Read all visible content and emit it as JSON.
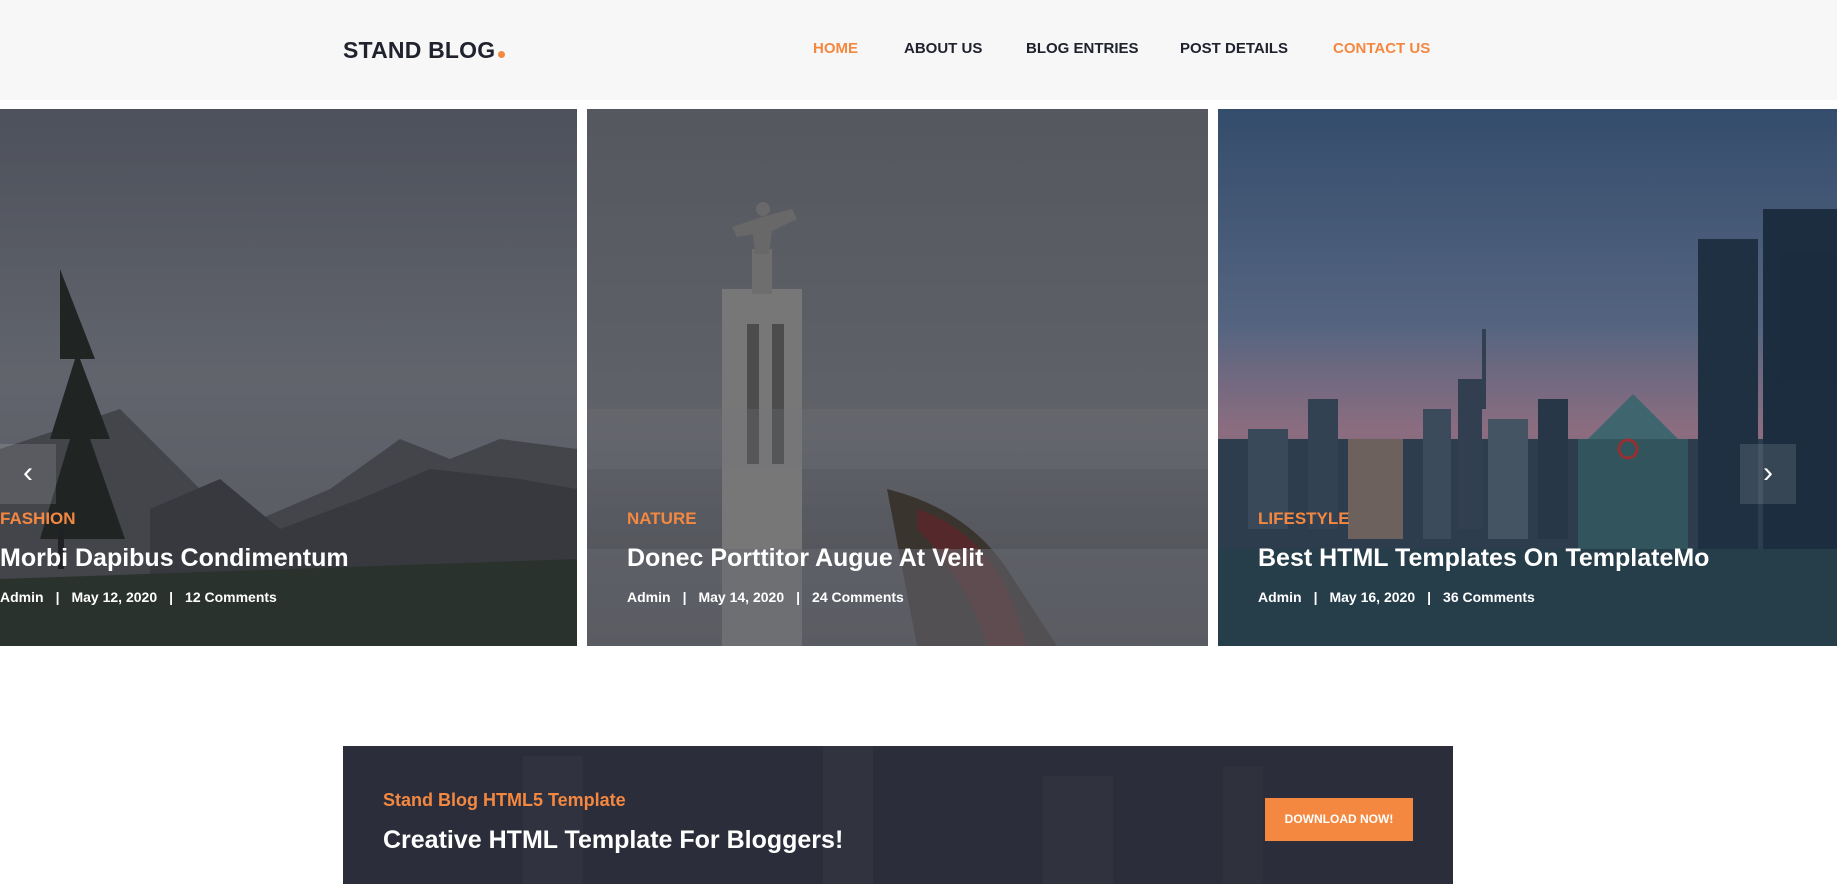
{
  "brand": {
    "name": "STAND BLOG",
    "accent_color": "#f48840"
  },
  "nav": [
    {
      "label": "HOME",
      "active": true
    },
    {
      "label": "ABOUT US",
      "active": false
    },
    {
      "label": "BLOG ENTRIES",
      "active": false
    },
    {
      "label": "POST DETAILS",
      "active": false
    },
    {
      "label": "CONTACT US",
      "active": true
    }
  ],
  "slider": {
    "prev_icon": "chevron-left-icon",
    "prev_glyph": "‹",
    "next_icon": "chevron-right-icon",
    "next_glyph": "›",
    "slides": [
      {
        "category": "FASHION",
        "title": "Morbi Dapibus Condimentum",
        "author": "Admin",
        "date": "May 12, 2020",
        "comments": "12 Comments",
        "image": "mountain-landscape"
      },
      {
        "category": "NATURE",
        "title": "Donec Porttitor Augue At Velit",
        "author": "Admin",
        "date": "May 14, 2020",
        "comments": "24 Comments",
        "image": "statue-in-clouds"
      },
      {
        "category": "LIFESTYLE",
        "title": "Best HTML Templates On TemplateMo",
        "author": "Admin",
        "date": "May 16, 2020",
        "comments": "36 Comments",
        "image": "city-skyline"
      }
    ]
  },
  "cta": {
    "subtitle": "Stand Blog HTML5 Template",
    "title": "Creative HTML Template For Bloggers!",
    "button": "DOWNLOAD NOW!"
  }
}
